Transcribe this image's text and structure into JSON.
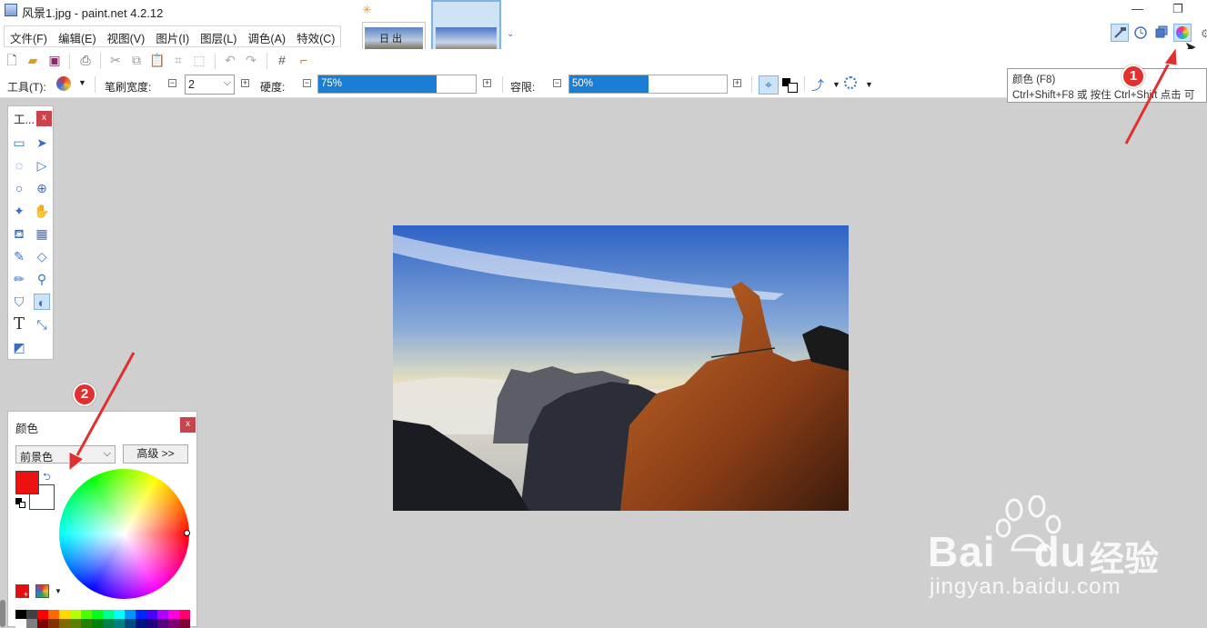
{
  "window": {
    "title": "风景1.jpg - paint.net 4.2.12",
    "minimize_glyph": "—",
    "restore_glyph": "❐"
  },
  "menu": [
    "文件(F)",
    "编辑(E)",
    "视图(V)",
    "图片(I)",
    "图层(L)",
    "调色(A)",
    "特效(C)"
  ],
  "image_tabs": [
    {
      "label": "日出",
      "selected": false
    },
    {
      "label": "",
      "selected": true
    }
  ],
  "options_bar": {
    "tool_label": "工具(T):",
    "brush_width_label": "笔刷宽度:",
    "brush_width_value": "2",
    "hardness_label": "硬度:",
    "hardness_value": "75%",
    "hardness_percent": 75,
    "tolerance_label": "容限:",
    "tolerance_value": "50%",
    "tolerance_percent": 50
  },
  "tooltip": {
    "line1": "颜色 (F8)",
    "line2": "Ctrl+Shift+F8 或 按住 Ctrl+Shift 点击 可"
  },
  "tools_panel": {
    "title": "工...",
    "close": "x",
    "tools": [
      "rectangle-select-icon",
      "move-selection-icon",
      "lasso-icon",
      "move-selected-icon",
      "ellipse-select-icon",
      "zoom-icon",
      "magic-wand-icon",
      "pan-icon",
      "paint-bucket-icon",
      "gradient-icon",
      "paintbrush-icon",
      "eraser-icon",
      "pencil-icon",
      "color-picker-icon",
      "clone-stamp-icon",
      "recolor-icon",
      "text-icon",
      "line-curve-icon",
      "shapes-icon"
    ]
  },
  "colors_panel": {
    "title": "颜色",
    "close": "x",
    "mode": "前景色",
    "advanced_button": "高级 >>",
    "primary_color": "#ee1111",
    "secondary_color": "#ffffff",
    "palette": [
      "#000000",
      "#404040",
      "#ff0000",
      "#ff6a00",
      "#ffd800",
      "#b6ff00",
      "#4cff00",
      "#00ff21",
      "#00ff90",
      "#00ffff",
      "#0094ff",
      "#0026ff",
      "#4800ff",
      "#b200ff",
      "#ff00dc",
      "#ff006e",
      "#ffffff",
      "#808080",
      "#7f0000",
      "#7f3300",
      "#7f6a00",
      "#5b7f00",
      "#267f00",
      "#007f0e",
      "#007f46",
      "#007f7f",
      "#004a7f",
      "#00137f",
      "#21007f",
      "#57007f",
      "#7f006e",
      "#7f0037"
    ]
  },
  "annotations": {
    "badge1": "1",
    "badge2": "2"
  },
  "watermark": {
    "brand": "Bai",
    "brand2": "du",
    "cn": "经验",
    "url": "jingyan.baidu.com"
  }
}
